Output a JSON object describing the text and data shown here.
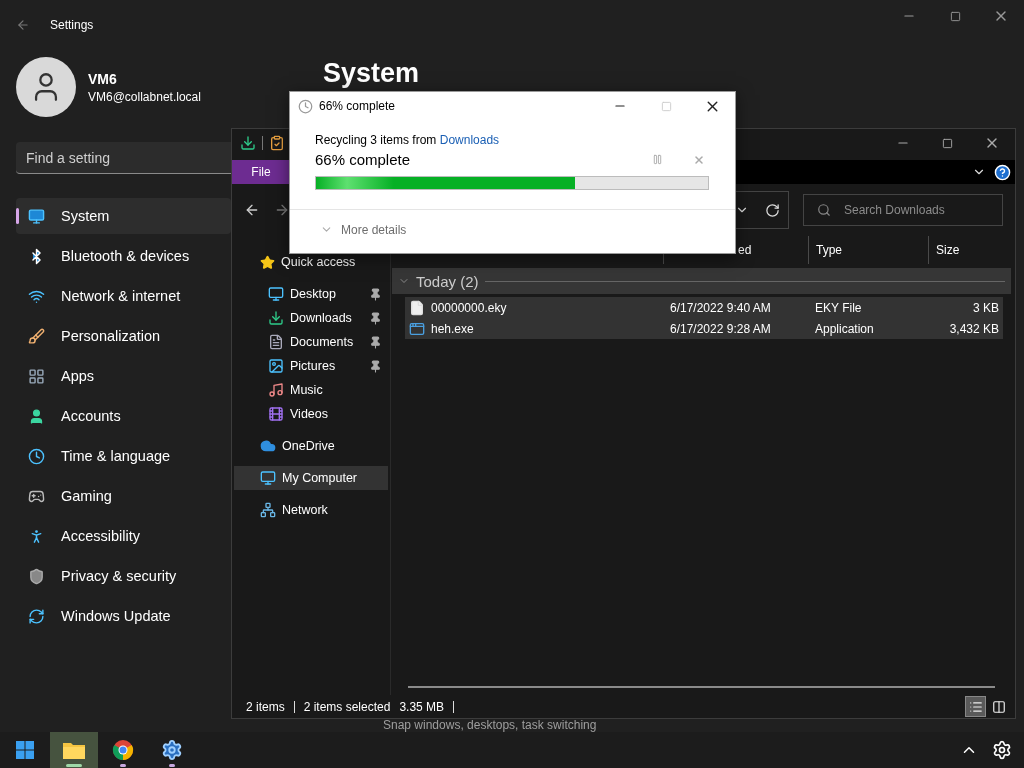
{
  "settings": {
    "title": "Settings",
    "user": {
      "name": "VM6",
      "email": "VM6@collabnet.local"
    },
    "search": {
      "placeholder": "Find a setting"
    },
    "nav": [
      {
        "label": "System",
        "selected": true
      },
      {
        "label": "Bluetooth & devices",
        "selected": false
      },
      {
        "label": "Network & internet",
        "selected": false
      },
      {
        "label": "Personalization",
        "selected": false
      },
      {
        "label": "Apps",
        "selected": false
      },
      {
        "label": "Accounts",
        "selected": false
      },
      {
        "label": "Time & language",
        "selected": false
      },
      {
        "label": "Gaming",
        "selected": false
      },
      {
        "label": "Accessibility",
        "selected": false
      },
      {
        "label": "Privacy & security",
        "selected": false
      },
      {
        "label": "Windows Update",
        "selected": false
      }
    ],
    "page_title": "System",
    "hint": "Snap windows, desktops, task switching"
  },
  "explorer": {
    "ribbon_tab": "File",
    "search": {
      "placeholder": "Search Downloads"
    },
    "columns": [
      "ed",
      "Type",
      "Size"
    ],
    "tree": [
      {
        "label": "Quick access",
        "selected": false,
        "children": [
          {
            "label": "Desktop",
            "pinned": true,
            "selected": false
          },
          {
            "label": "Downloads",
            "pinned": true,
            "selected": false
          },
          {
            "label": "Documents",
            "pinned": true,
            "selected": false
          },
          {
            "label": "Pictures",
            "pinned": true,
            "selected": false
          },
          {
            "label": "Music",
            "pinned": false,
            "selected": false
          },
          {
            "label": "Videos",
            "pinned": false,
            "selected": false
          }
        ]
      },
      {
        "label": "OneDrive",
        "selected": false
      },
      {
        "label": "My Computer",
        "selected": true
      },
      {
        "label": "Network",
        "selected": false
      }
    ],
    "group": {
      "label": "Today (2)",
      "expanded": true
    },
    "files": [
      {
        "name": "00000000.eky",
        "date": "6/17/2022 9:40 AM",
        "type": "EKY File",
        "size": "3 KB",
        "selected": true
      },
      {
        "name": "heh.exe",
        "date": "6/17/2022 9:28 AM",
        "type": "Application",
        "size": "3,432 KB",
        "selected": true
      }
    ],
    "status": {
      "count": "2 items",
      "selection": "2 items selected",
      "size": "3.35 MB"
    },
    "views": [
      {
        "selected": true
      },
      {
        "selected": false
      }
    ]
  },
  "dialog": {
    "title": "66% complete",
    "message": "Recycling 3 items from",
    "source": "Downloads",
    "progress_text": "66% complete",
    "level": 0.66,
    "details": "More details"
  },
  "taskbar": {
    "apps": [
      {
        "active": true
      },
      {
        "active": false
      },
      {
        "active": false
      }
    ]
  }
}
